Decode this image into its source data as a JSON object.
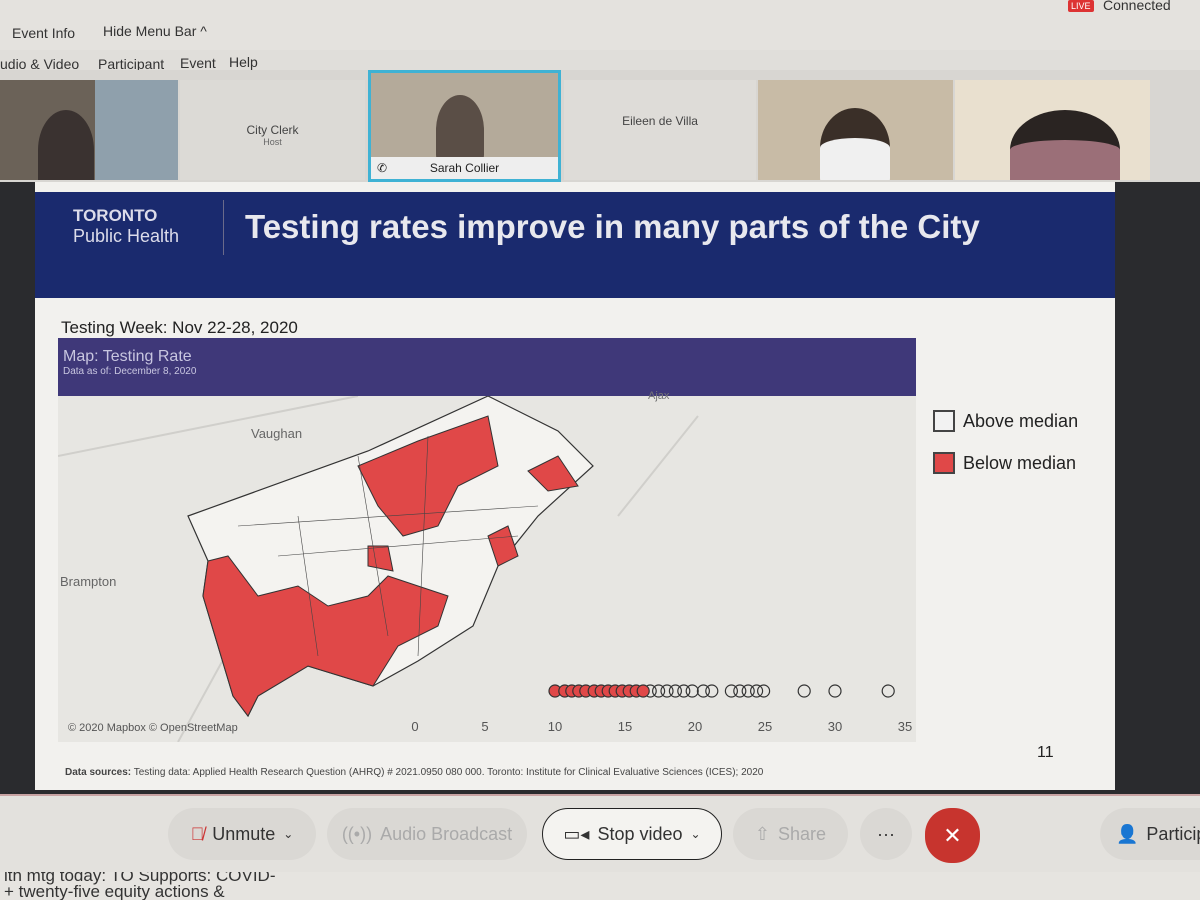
{
  "status": {
    "live_badge": "LIVE",
    "connection": "Connected"
  },
  "menu": {
    "event_info": "Event Info",
    "hide_menu_bar": "Hide Menu Bar ^",
    "items": [
      "udio & Video",
      "Participant",
      "Event",
      "Help"
    ]
  },
  "participants": [
    {
      "name": "City Clerk",
      "role": "Host"
    },
    {
      "name": "Sarah Collier",
      "active": true
    },
    {
      "name": "Eileen de Villa"
    }
  ],
  "slide": {
    "logo_top": "TORONTO",
    "logo_bottom": "Public Health",
    "title": "Testing rates improve in many parts of the City",
    "testing_week": "Testing Week: Nov 22-28, 2020",
    "map_title": "Map: Testing Rate",
    "map_subtitle": "Data as of: December 8, 2020",
    "place_labels": [
      "Vaughan",
      "Brampton",
      "Ajax"
    ],
    "attribution": "© 2020 Mapbox © OpenStreetMap",
    "legend": [
      {
        "label": "Above median",
        "color": "#f2f2f2"
      },
      {
        "label": "Below median",
        "color": "#e04848"
      }
    ],
    "page_number": "11",
    "sources_label": "Data sources:",
    "sources_text": "Testing data: Applied Health Research Question (AHRQ) # 2021.0950 080 000. Toronto: Institute for Clinical Evaluative Sciences (ICES); 2020"
  },
  "chart_data": {
    "type": "scatter",
    "xlim": [
      0,
      35
    ],
    "ticks": [
      "0",
      "5",
      "10",
      "15",
      "20",
      "25",
      "30",
      "35"
    ],
    "below_median": [
      10,
      10.7,
      11.2,
      11.7,
      12.2,
      12.8,
      13.3,
      13.8,
      14.3,
      14.8,
      15.3,
      15.8,
      16.3
    ],
    "above_median": [
      16.8,
      17.4,
      18,
      18.6,
      19.2,
      19.8,
      20.6,
      21.2,
      22.6,
      23.2,
      23.8,
      24.4,
      24.9,
      27.8,
      30,
      33.8
    ]
  },
  "toolbar": {
    "unmute": "Unmute",
    "audio_broadcast": "Audio Broadcast",
    "stop_video": "Stop video",
    "share": "Share",
    "more": "···",
    "participants": "Particip"
  },
  "footer": {
    "line1": "ith mtg today: TO Supports: COVID-",
    "line2": "+ twenty-five equity actions &"
  }
}
